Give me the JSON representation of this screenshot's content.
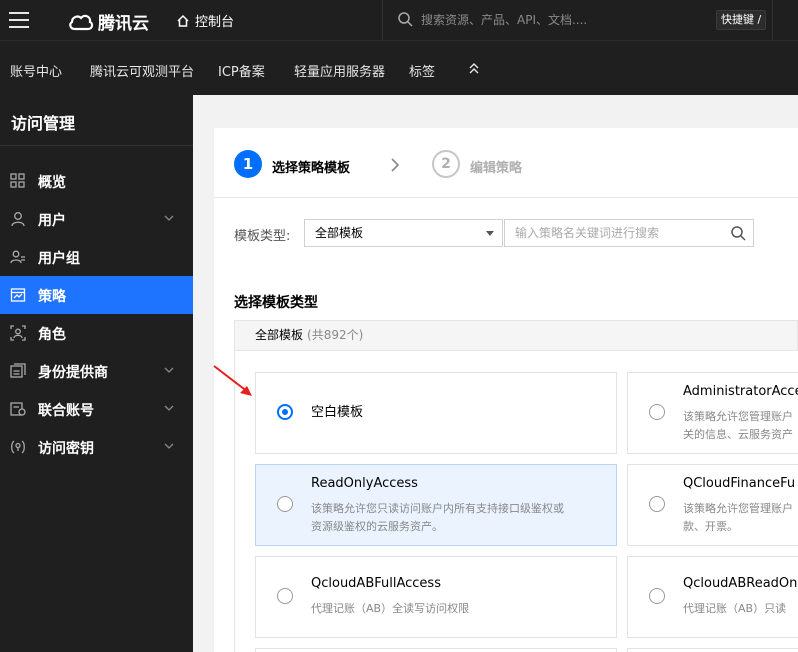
{
  "topbar": {
    "logo_text": "腾讯云",
    "console_label": "控制台",
    "search_placeholder": "搜索资源、产品、API、文档....",
    "shortcut_label": "快捷键 /"
  },
  "navbar": {
    "items": [
      "账号中心",
      "腾讯云可观测平台",
      "ICP备案",
      "轻量应用服务器",
      "标签"
    ]
  },
  "sidebar": {
    "title": "访问管理",
    "items": [
      {
        "label": "概览",
        "icon": "overview-icon",
        "has_arrow": false
      },
      {
        "label": "用户",
        "icon": "user-icon",
        "has_arrow": true
      },
      {
        "label": "用户组",
        "icon": "user-group-icon",
        "has_arrow": false
      },
      {
        "label": "策略",
        "icon": "policy-icon",
        "has_arrow": false,
        "active": true
      },
      {
        "label": "角色",
        "icon": "role-icon",
        "has_arrow": false
      },
      {
        "label": "身份提供商",
        "icon": "identity-provider-icon",
        "has_arrow": true
      },
      {
        "label": "联合账号",
        "icon": "federated-account-icon",
        "has_arrow": true
      },
      {
        "label": "访问密钥",
        "icon": "access-key-icon",
        "has_arrow": true
      }
    ]
  },
  "steps": {
    "step1_number": "1",
    "step1_label": "选择策略模板",
    "step2_number": "2",
    "step2_label": "编辑策略"
  },
  "filter": {
    "label": "模板类型:",
    "select_value": "全部模板",
    "keyword_placeholder": "输入策略名关键词进行搜索"
  },
  "section": {
    "title": "选择模板类型",
    "all_label": "全部模板",
    "count_label": "(共892个)"
  },
  "templates": [
    {
      "name": "空白模板",
      "desc1": "",
      "desc2": "",
      "checked": true
    },
    {
      "name": "AdministratorAcce",
      "desc1": "该策略允许您管理账户",
      "desc2": "关的信息、云服务资产"
    },
    {
      "name": "ReadOnlyAccess",
      "desc1": "该策略允许您只读访问账户内所有支持接口级鉴权或",
      "desc2": "资源级鉴权的云服务资产。"
    },
    {
      "name": "QCloudFinanceFu",
      "desc1": "该策略允许您管理账户",
      "desc2": "款、开票。"
    },
    {
      "name": "QcloudABFullAccess",
      "desc1": "代理记账（AB）全读写访问权限",
      "desc2": ""
    },
    {
      "name": "QcloudABReadOn",
      "desc1": "代理记账（AB）只读",
      "desc2": ""
    }
  ],
  "colors": {
    "brand_blue": "#006eff",
    "sidebar_active": "#1f74ff",
    "annotation_red": "#e8201c"
  }
}
